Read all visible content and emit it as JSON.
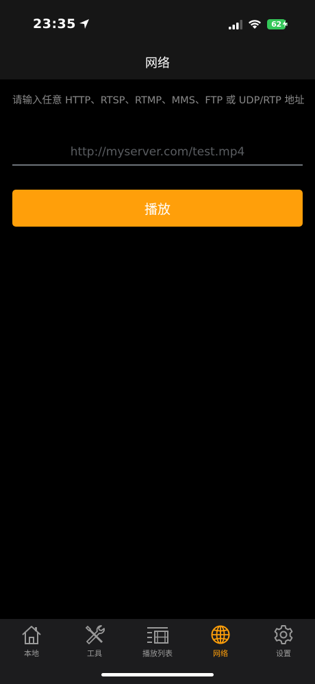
{
  "status_bar": {
    "time": "23:35",
    "battery": "62"
  },
  "nav": {
    "title": "网络"
  },
  "form": {
    "instruction": "请输入任意 HTTP、RTSP、RTMP、MMS、FTP 或 UDP/RTP 地址",
    "url_value": "",
    "url_placeholder": "http://myserver.com/test.mp4",
    "play_label": "播放"
  },
  "tabs": [
    {
      "label": "本地",
      "icon": "home-icon",
      "active": false
    },
    {
      "label": "工具",
      "icon": "tools-icon",
      "active": false
    },
    {
      "label": "播放列表",
      "icon": "playlist-icon",
      "active": false
    },
    {
      "label": "网络",
      "icon": "globe-icon",
      "active": true
    },
    {
      "label": "设置",
      "icon": "gear-icon",
      "active": false
    }
  ],
  "colors": {
    "accent": "#ff9f0a",
    "battery": "#34c759",
    "background": "#000000",
    "inactive_tab": "#9a9a9a"
  }
}
